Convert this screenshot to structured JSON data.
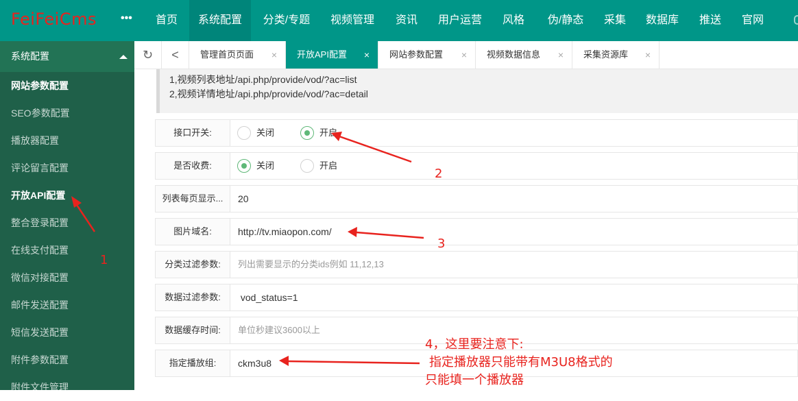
{
  "app": {
    "logo": "FeiFeiCms",
    "more_glyph": "•••"
  },
  "topnav": [
    {
      "label": "首页",
      "active": false
    },
    {
      "label": "系统配置",
      "active": true
    },
    {
      "label": "分类/专题",
      "active": false
    },
    {
      "label": "视频管理",
      "active": false
    },
    {
      "label": "资讯",
      "active": false
    },
    {
      "label": "用户运营",
      "active": false
    },
    {
      "label": "风格",
      "active": false
    },
    {
      "label": "伪/静态",
      "active": false
    },
    {
      "label": "采集",
      "active": false
    },
    {
      "label": "数据库",
      "active": false
    },
    {
      "label": "推送",
      "active": false
    },
    {
      "label": "官网",
      "active": false
    }
  ],
  "sidebar": {
    "header": "系统配置",
    "items": [
      {
        "label": "网站参数配置",
        "bold": true
      },
      {
        "label": "SEO参数配置",
        "bold": false
      },
      {
        "label": "播放器配置",
        "bold": false
      },
      {
        "label": "评论留言配置",
        "bold": false
      },
      {
        "label": "开放API配置",
        "bold": true
      },
      {
        "label": "整合登录配置",
        "bold": false
      },
      {
        "label": "在线支付配置",
        "bold": false
      },
      {
        "label": "微信对接配置",
        "bold": false
      },
      {
        "label": "邮件发送配置",
        "bold": false
      },
      {
        "label": "短信发送配置",
        "bold": false
      },
      {
        "label": "附件参数配置",
        "bold": false
      },
      {
        "label": "附件文件管理",
        "bold": false
      }
    ]
  },
  "tabs": {
    "refresh_glyph": "↻",
    "back_glyph": "<",
    "close_glyph": "×",
    "items": [
      {
        "label": "管理首页页面",
        "active": false
      },
      {
        "label": "开放API配置",
        "active": true
      },
      {
        "label": "网站参数配置",
        "active": false
      },
      {
        "label": "视频数据信息",
        "active": false
      },
      {
        "label": "采集资源库",
        "active": false
      }
    ]
  },
  "notice": {
    "line1": "1,视频列表地址/api.php/provide/vod/?ac=list",
    "line2": "2,视频详情地址/api.php/provide/vod/?ac=detail"
  },
  "form": {
    "api_switch": {
      "label": "接口开关:",
      "options": [
        "关闭",
        "开启"
      ],
      "selected": "开启"
    },
    "charge": {
      "label": "是否收费:",
      "options": [
        "关闭",
        "开启"
      ],
      "selected": "关闭"
    },
    "page_size": {
      "label": "列表每页显示...",
      "value": "20"
    },
    "image_domain": {
      "label": "图片域名:",
      "value": "http://tv.miaopon.com/"
    },
    "category_filter": {
      "label": "分类过滤参数:",
      "value": "",
      "placeholder": "列出需要显示的分类ids例如 11,12,13"
    },
    "data_filter": {
      "label": "数据过滤参数:",
      "value": " vod_status=1"
    },
    "cache_time": {
      "label": "数据缓存时间:",
      "value": "",
      "placeholder": "单位秒建议3600以上"
    },
    "player_group": {
      "label": "指定播放组:",
      "value": "ckm3u8"
    }
  },
  "annotations": {
    "n1": "1",
    "n2": "2",
    "n3": "3",
    "n4_line1": "4，这里要注意下:",
    "n4_line2": "指定播放器只能带有M3U8格式的",
    "n4_line3": "只能填一个播放器",
    "color": "#e8231e"
  },
  "colors": {
    "brand": "#009688",
    "sidebar": "#1f6049",
    "radio_on": "#5fb878"
  }
}
